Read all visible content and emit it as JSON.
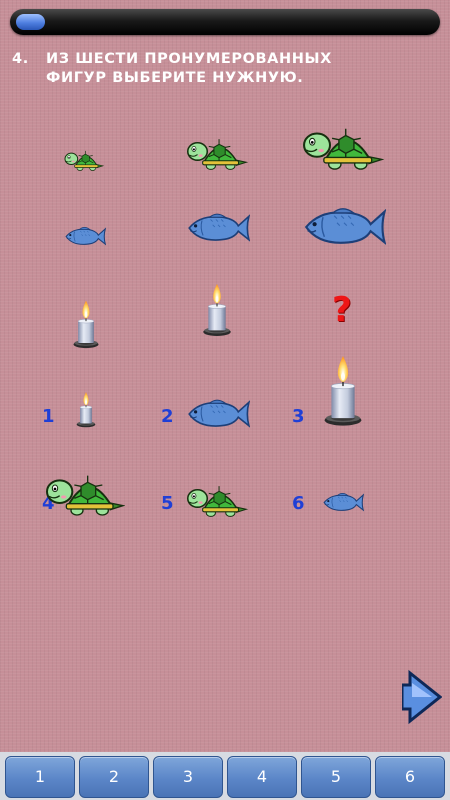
{
  "progress": {
    "fraction": 0.07,
    "fill_color": "#4f7fe0"
  },
  "question": {
    "number": "4.",
    "line1": "ИЗ ШЕСТИ ПРОНУМЕРОВАННЫХ",
    "line2": "ФИГУР ВЫБЕРИТЕ НУЖНУЮ."
  },
  "puzzle_grid": [
    [
      "turtle-small",
      "turtle-medium",
      "turtle-large"
    ],
    [
      "fish-small",
      "fish-medium",
      "fish-large"
    ],
    [
      "candle-small",
      "candle-medium",
      "question-mark"
    ]
  ],
  "missing_cell_symbol": "?",
  "options": [
    {
      "number": "1",
      "figure": "candle-small"
    },
    {
      "number": "2",
      "figure": "fish-medium"
    },
    {
      "number": "3",
      "figure": "candle-large"
    },
    {
      "number": "4",
      "figure": "turtle-large"
    },
    {
      "number": "5",
      "figure": "turtle-medium"
    },
    {
      "number": "6",
      "figure": "fish-small"
    }
  ],
  "answer_buttons": [
    "1",
    "2",
    "3",
    "4",
    "5",
    "6"
  ],
  "icons": {
    "next": "next-arrow-icon"
  },
  "colors": {
    "background": "#c68f98",
    "option_number": "#1f3fd6",
    "question_mark": "#ee1616",
    "answer_button": "#5b86c8",
    "question_text": "#ffffff"
  }
}
